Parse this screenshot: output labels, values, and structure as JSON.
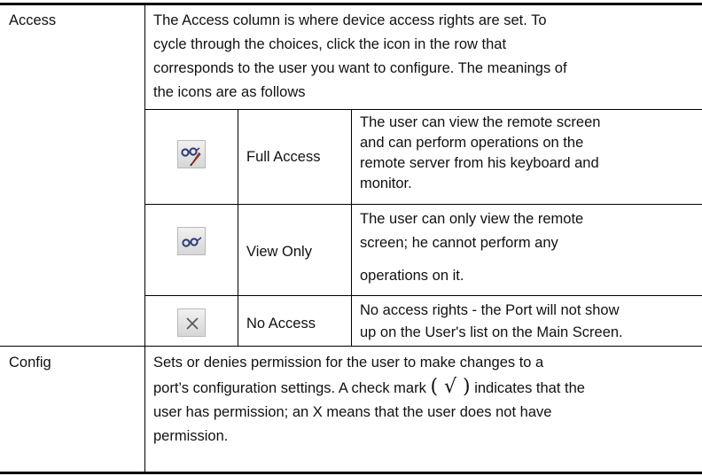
{
  "access": {
    "label": "Access",
    "description_lines": [
      "The Access column is where device access rights are set. To",
      "cycle through the choices, click the icon in the row that",
      "corresponds to the user you want to configure. The meanings of",
      "the icons are as follows"
    ],
    "options": [
      {
        "icon": "full-access-icon",
        "name": "Full Access",
        "lines": [
          "The user can view the remote screen",
          "and can perform operations on the",
          "remote server from his keyboard and",
          "monitor."
        ]
      },
      {
        "icon": "view-only-icon",
        "name": "View Only",
        "lines": [
          "The user can only view the remote",
          "screen; he cannot perform any",
          "operations on it."
        ]
      },
      {
        "icon": "no-access-icon",
        "name": "No Access",
        "lines": [
          "No access rights - the Port will not show",
          "up on the User's list on the Main Screen."
        ]
      }
    ]
  },
  "config": {
    "label": "Config",
    "line1": "Sets or denies permission for the user to make changes to a",
    "line2_before": "port’s configuration settings. A check mark ",
    "check_symbol": "( √ )",
    "line2_after": " indicates that the",
    "line3": "user has permission; an X means that the user does not have",
    "line4": "permission."
  }
}
